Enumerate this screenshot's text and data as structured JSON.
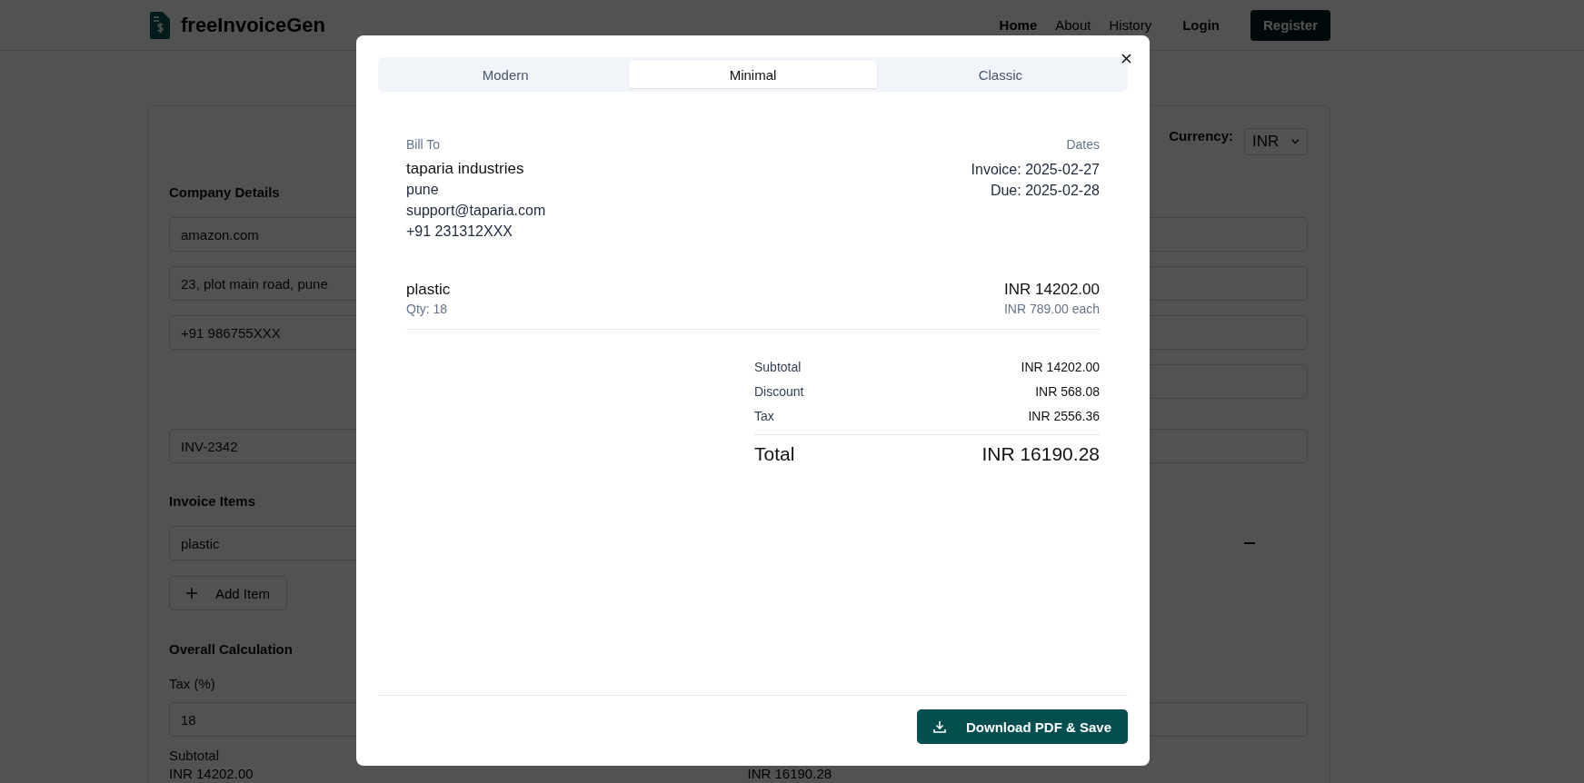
{
  "header": {
    "brand": "freeInvoiceGen",
    "nav": [
      {
        "label": "Home",
        "selected": true
      },
      {
        "label": "About",
        "selected": false
      },
      {
        "label": "History",
        "selected": false
      }
    ],
    "login": "Login",
    "register": "Register"
  },
  "form": {
    "currency_label": "Currency:",
    "currency": "INR",
    "company_heading": "Company Details",
    "company_fields": [
      "amazon.com",
      "23, plot main road, pune",
      "+91 986755XXX"
    ],
    "invoice_number": "INV-2342",
    "items_heading": "Invoice Items",
    "item_name": "plastic",
    "add_item": "Add Item",
    "calc_heading": "Overall Calculation",
    "tax_label": "Tax (%)",
    "tax_value": "18",
    "subtotal_label": "Subtotal",
    "subtotal_value": "INR 14202.00",
    "total_value": "INR 16190.28"
  },
  "modal": {
    "tabs": [
      {
        "label": "Modern",
        "selected": false
      },
      {
        "label": "Minimal",
        "selected": true
      },
      {
        "label": "Classic",
        "selected": false
      }
    ],
    "bill_to": {
      "heading": "Bill To",
      "name": "taparia industries",
      "lines": [
        "pune",
        "support@taparia.com",
        "+91 231312XXX"
      ]
    },
    "dates": {
      "heading": "Dates",
      "lines": [
        "Invoice: 2025-02-27",
        "Due: 2025-02-28"
      ]
    },
    "items": [
      {
        "name": "plastic",
        "qty": "Qty: 18",
        "amount": "INR 14202.00",
        "unit": "INR 789.00 each"
      }
    ],
    "totals": [
      {
        "label": "Subtotal",
        "value": "INR 14202.00"
      },
      {
        "label": "Discount",
        "value": "INR 568.08"
      },
      {
        "label": "Tax",
        "value": "INR 2556.36"
      }
    ],
    "total": {
      "label": "Total",
      "value": "INR 16190.28"
    },
    "download": "Download PDF & Save"
  }
}
